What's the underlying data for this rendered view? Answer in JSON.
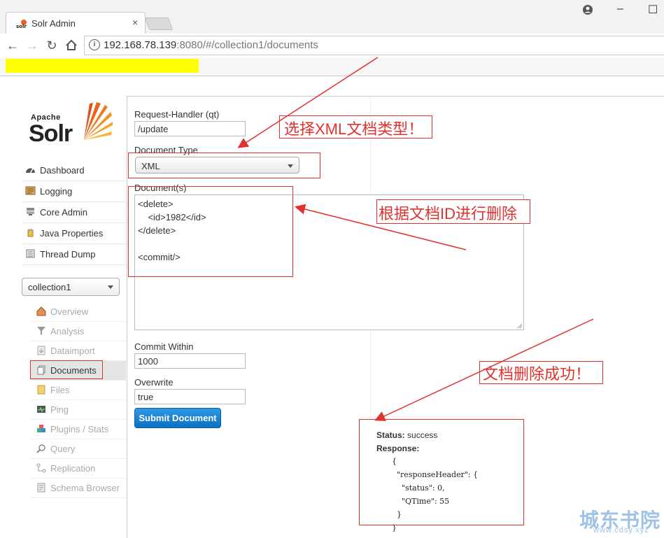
{
  "browser": {
    "tab_title": "Solr Admin",
    "tab_close": "×",
    "url_host": "192.168.78.139",
    "url_port": ":8080",
    "url_path": "/#/collection1/documents",
    "win_minimize": "–",
    "win_restore": "☐"
  },
  "logo": {
    "apache": "Apache",
    "solr": "Solr"
  },
  "sidebar": {
    "items": [
      {
        "label": "Dashboard",
        "icon": "dashboard-icon"
      },
      {
        "label": "Logging",
        "icon": "logging-icon"
      },
      {
        "label": "Core Admin",
        "icon": "core-admin-icon"
      },
      {
        "label": "Java Properties",
        "icon": "java-properties-icon"
      },
      {
        "label": "Thread Dump",
        "icon": "thread-dump-icon"
      }
    ],
    "collection": "collection1",
    "core_items": [
      {
        "label": "Overview",
        "icon": "overview-icon"
      },
      {
        "label": "Analysis",
        "icon": "analysis-icon"
      },
      {
        "label": "Dataimport",
        "icon": "dataimport-icon"
      },
      {
        "label": "Documents",
        "icon": "documents-icon"
      },
      {
        "label": "Files",
        "icon": "files-icon"
      },
      {
        "label": "Ping",
        "icon": "ping-icon"
      },
      {
        "label": "Plugins / Stats",
        "icon": "plugins-icon"
      },
      {
        "label": "Query",
        "icon": "query-icon"
      },
      {
        "label": "Replication",
        "icon": "replication-icon"
      },
      {
        "label": "Schema Browser",
        "icon": "schema-browser-icon"
      }
    ]
  },
  "form": {
    "handler_label": "Request-Handler (qt)",
    "handler_value": "/update",
    "doctype_label": "Document Type",
    "doctype_value": "XML",
    "docs_label": "Document(s)",
    "docs_lines": [
      "<delete>",
      "    <id>1982</id>",
      "</delete>",
      "",
      "<commit/>"
    ],
    "commit_label": "Commit Within",
    "commit_value": "1000",
    "overwrite_label": "Overwrite",
    "overwrite_value": "true",
    "submit_label": "Submit Document"
  },
  "response": {
    "status_label": "Status:",
    "status_value": "success",
    "response_label": "Response:",
    "lines": [
      "{",
      "  \"responseHeader\": {",
      "    \"status\": 0,",
      "    \"QTime\": 55",
      "  }",
      "}"
    ]
  },
  "annotations": {
    "doctype": "选择XML文档类型！",
    "delete_by_id": "根据文档ID进行删除",
    "success": "文档删除成功！"
  },
  "watermark": {
    "main": "城东书院",
    "sub": "www.cdsy.xyz"
  },
  "colors": {
    "annotation": "#e0322f",
    "submit": "#1a82d4",
    "highlight": "#ffff00"
  }
}
